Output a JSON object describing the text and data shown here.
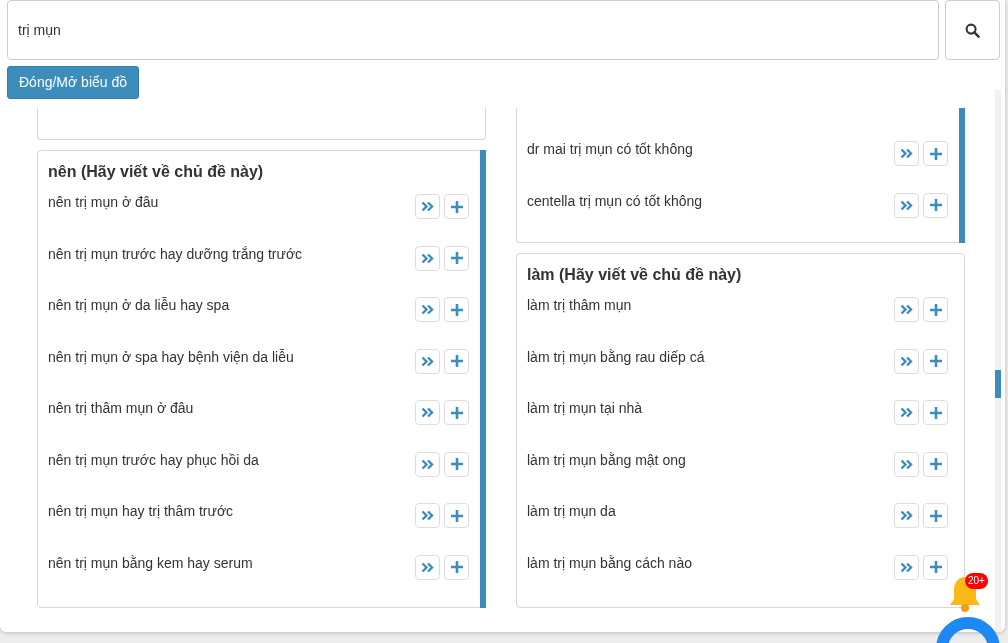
{
  "search": {
    "value": "trị mụn"
  },
  "toggle_button": "Đóng/Mở biểu đồ",
  "columns": [
    {
      "cards": [
        {
          "scrollable": false
        },
        {
          "title": "nên (Hãy viết về chủ đề này)",
          "scrollable": true,
          "rows": [
            "nên trị mụn ở đâu",
            "nên trị mụn trước hay dưỡng trắng trước",
            "nên trị mụn ở da liễu hay spa",
            "nên trị mụn ở spa hay bệnh viện da liễu",
            "nên trị thâm mụn ở đâu",
            "nên trị mụn trước hay phục hồi da",
            "nên trị mụn hay trị thâm trước",
            "nên trị mụn bằng kem hay serum"
          ]
        }
      ]
    },
    {
      "cards": [
        {
          "scrollable": true,
          "rows": [
            "dr mai trị mụn có tốt không",
            "centella trị mụn có tốt không"
          ]
        },
        {
          "title": "làm (Hãy viết về chủ đề này)",
          "scrollable": false,
          "rows": [
            "làm trị thâm mụn",
            "làm trị mụn bằng rau diếp cá",
            "làm trị mụn tại nhà",
            "làm trị mụn bằng mật ong",
            "làm trị mụn da",
            "làm trị mụn bằng cách nào"
          ]
        }
      ]
    }
  ],
  "notification": {
    "badge": "20+"
  }
}
